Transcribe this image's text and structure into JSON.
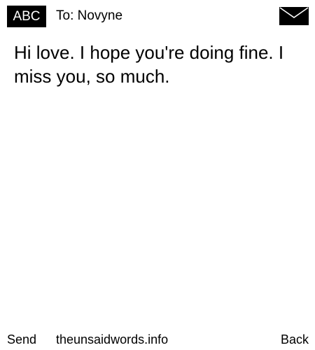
{
  "header": {
    "input_mode": "ABC",
    "recipient": "To: Novyne",
    "message_icon": "envelope-icon"
  },
  "message": {
    "text": "Hi love. I hope you're doing fine. I miss you, so much."
  },
  "softkeys": {
    "left": "Send",
    "center": "theunsaidwords.info",
    "right": "Back"
  },
  "colors": {
    "background": "#ffffff",
    "foreground": "#000000"
  }
}
